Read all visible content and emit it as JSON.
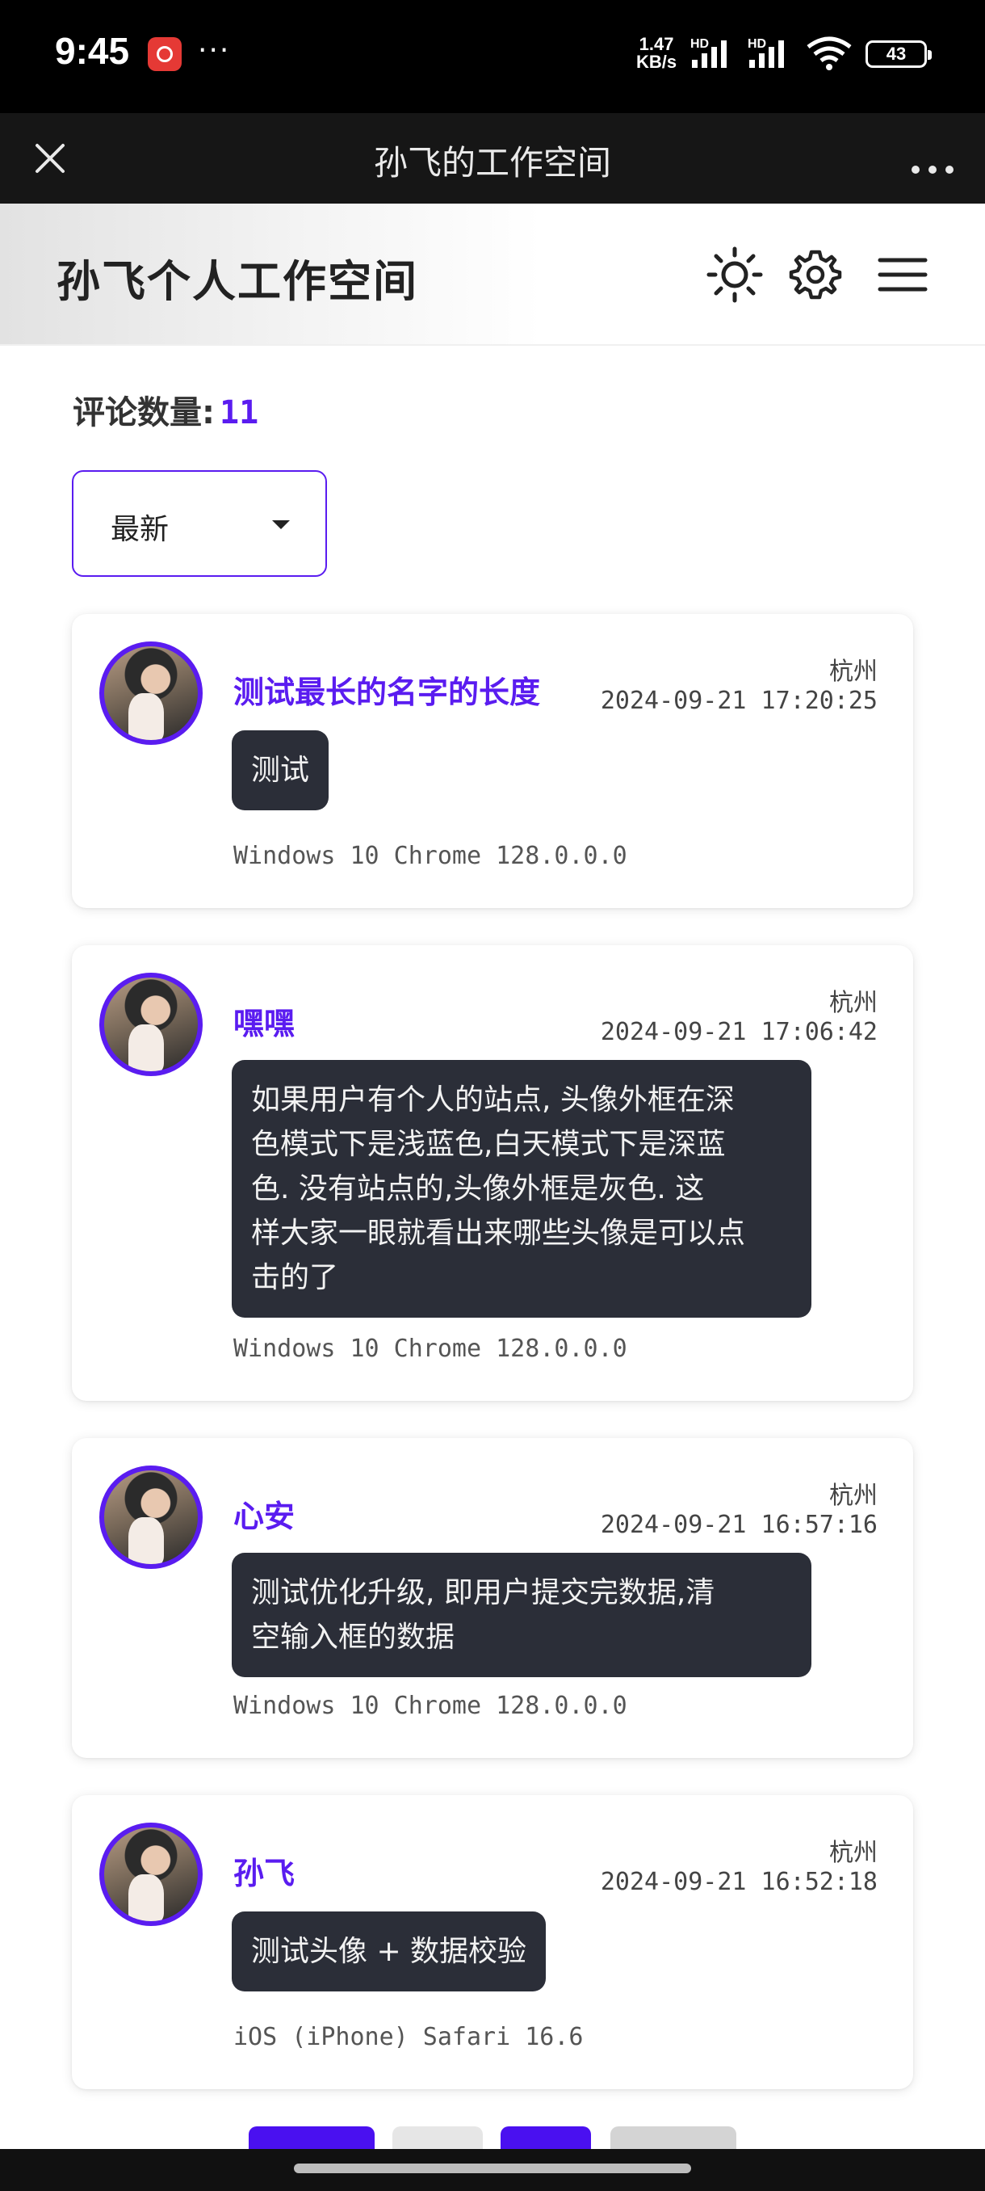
{
  "status_bar": {
    "time": "9:45",
    "more": "···",
    "speed_value": "1.47",
    "speed_unit": "KB/s",
    "hd1": "HD",
    "hd2": "HD",
    "battery": "43"
  },
  "nav": {
    "title": "孙飞的工作空间",
    "close_icon": "close-icon",
    "more_icon": "more-horizontal-icon"
  },
  "header": {
    "site_title": "孙飞个人工作空间",
    "icons": [
      "sun-icon",
      "gear-icon",
      "menu-icon"
    ]
  },
  "comments_header": {
    "label": "评论数量:",
    "count": "11"
  },
  "sort": {
    "selected": "最新"
  },
  "comments": [
    {
      "name": "测试最长的名字的长度",
      "location": "杭州",
      "time": "2024-09-21 17:20:25",
      "lines": [
        "测试"
      ],
      "ua": "Windows 10 Chrome 128.0.0.0"
    },
    {
      "name": "嘿嘿",
      "location": "杭州",
      "time": "2024-09-21 17:06:42",
      "lines": [
        "如果用户有个人的站点, 头像外框在深",
        "色模式下是浅蓝色,白天模式下是深蓝",
        "色. 没有站点的,头像外框是灰色. 这",
        "样大家一眼就看出来哪些头像是可以点",
        "击的了"
      ],
      "ua": "Windows 10 Chrome 128.0.0.0"
    },
    {
      "name": "心安",
      "location": "杭州",
      "time": "2024-09-21 16:57:16",
      "lines": [
        "测试优化升级, 即用户提交完数据,清",
        "空输入框的数据"
      ],
      "ua": "Windows 10 Chrome 128.0.0.0"
    },
    {
      "name": "孙飞",
      "location": "杭州",
      "time": "2024-09-21 16:52:18",
      "lines": [
        "测试头像 + 数据校验"
      ],
      "ua": "iOS (iPhone) Safari 16.6"
    }
  ],
  "colors": {
    "accent": "#5a1cf0",
    "bubble": "#2b2e38",
    "page_inactive": "#e6e6e6"
  }
}
